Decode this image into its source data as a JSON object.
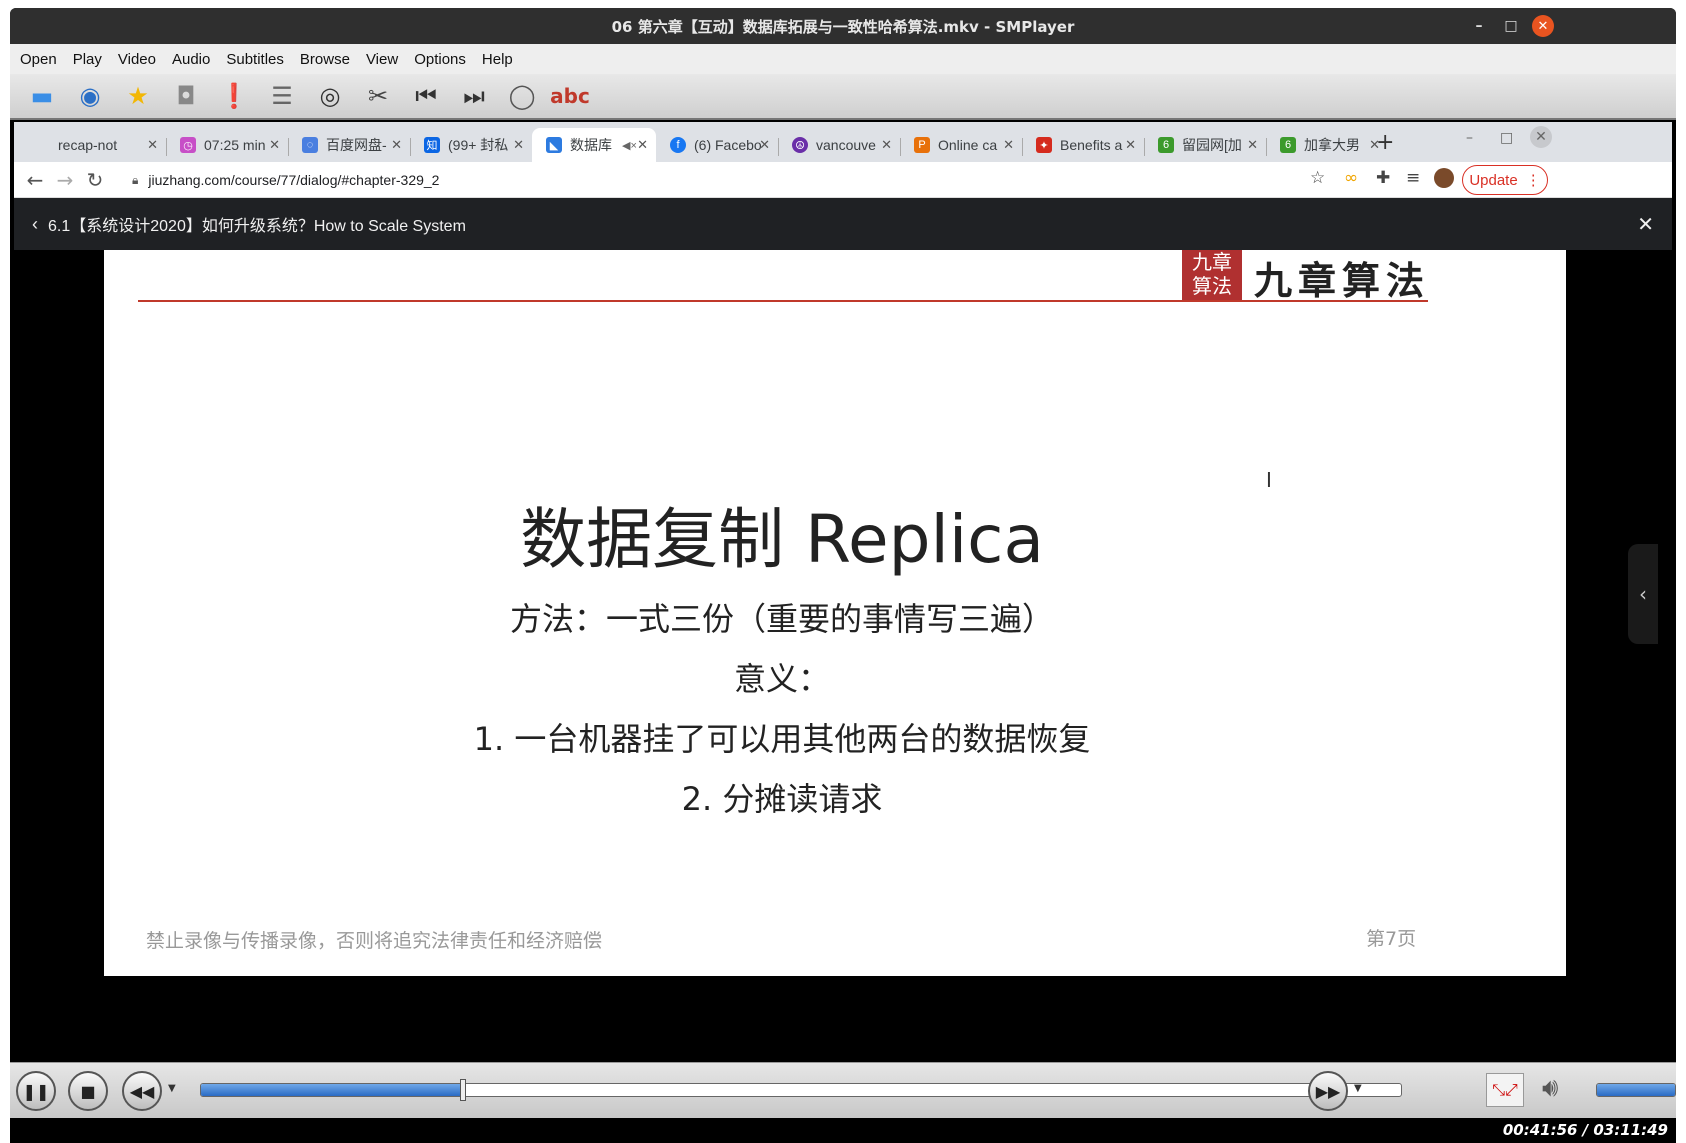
{
  "window": {
    "title": "06 第六章【互动】数据库拓展与一致性哈希算法.mkv - SMPlayer"
  },
  "menubar": [
    "Open",
    "Play",
    "Video",
    "Audio",
    "Subtitles",
    "Browse",
    "View",
    "Options",
    "Help"
  ],
  "browser": {
    "tabs": [
      {
        "label": "recap-not",
        "active": false
      },
      {
        "label": "07:25 min",
        "active": false
      },
      {
        "label": "百度网盘-",
        "active": false
      },
      {
        "label": "(99+ 封私",
        "active": false
      },
      {
        "label": "数据库",
        "active": true
      },
      {
        "label": "(6) Facebo",
        "active": false
      },
      {
        "label": "vancouve",
        "active": false
      },
      {
        "label": "Online ca",
        "active": false
      },
      {
        "label": "Benefits a",
        "active": false
      },
      {
        "label": "留园网[加",
        "active": false
      },
      {
        "label": "加拿大男",
        "active": false
      }
    ],
    "new_tab": "+",
    "url": "jiuzhang.com/course/77/dialog/#chapter-329_2",
    "update_label": "Update"
  },
  "course": {
    "back_title": "6.1【系统设计2020】如何升级系统？How to Scale System"
  },
  "slide": {
    "logo_seal": "九章算法",
    "logo_text": "九章算法",
    "title": "数据复制 Replica",
    "method": "方法：一式三份（重要的事情写三遍）",
    "meaning": "意义：",
    "point1": "1. 一台机器挂了可以用其他两台的数据恢复",
    "point2": "2. 分摊读请求",
    "footer": "禁止录像与传播录像，否则将追究法律责任和经济赔偿",
    "page": "第7页"
  },
  "player": {
    "time": "00:41:56 / 03:11:49",
    "progress_fraction": 0.219,
    "volume_fraction": 1.0
  },
  "colors": {
    "accent_red": "#c0392b",
    "seek_blue": "#2a6bc4",
    "update_red": "#d93025"
  }
}
